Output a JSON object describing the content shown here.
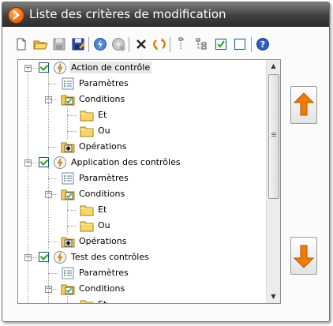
{
  "window": {
    "title": "Liste des critères de modification",
    "title_icon": "chevron-right-icon"
  },
  "toolbar": {
    "buttons": [
      {
        "name": "new-icon"
      },
      {
        "name": "open-folder-icon"
      },
      {
        "name": "save-icon"
      },
      {
        "name": "save-as-icon"
      },
      {
        "name": "validate-icon"
      },
      {
        "name": "validate-all-icon"
      },
      {
        "name": "delete-icon"
      },
      {
        "name": "refresh-icon"
      },
      {
        "name": "insert-icon"
      },
      {
        "name": "tree-view-icon"
      },
      {
        "name": "check-all-icon"
      },
      {
        "name": "uncheck-all-icon"
      },
      {
        "name": "help-icon"
      }
    ]
  },
  "tree": {
    "items": [
      {
        "label": "Action de contrôle",
        "level": 0,
        "icon": "lightning-icon",
        "checked": true,
        "expanded": true,
        "selected": true
      },
      {
        "label": "Paramètres",
        "level": 1,
        "icon": "parameters-icon"
      },
      {
        "label": "Conditions",
        "level": 1,
        "icon": "conditions-folder-icon",
        "expanded": true
      },
      {
        "label": "Et",
        "level": 2,
        "icon": "folder-icon"
      },
      {
        "label": "Ou",
        "level": 2,
        "icon": "folder-icon"
      },
      {
        "label": "Opérations",
        "level": 1,
        "icon": "operations-icon"
      },
      {
        "label": "Application des contrôles",
        "level": 0,
        "icon": "lightning-icon",
        "checked": true,
        "expanded": true
      },
      {
        "label": "Paramètres",
        "level": 1,
        "icon": "parameters-icon"
      },
      {
        "label": "Conditions",
        "level": 1,
        "icon": "conditions-folder-icon",
        "expanded": true
      },
      {
        "label": "Et",
        "level": 2,
        "icon": "folder-icon"
      },
      {
        "label": "Ou",
        "level": 2,
        "icon": "folder-icon"
      },
      {
        "label": "Opérations",
        "level": 1,
        "icon": "operations-icon"
      },
      {
        "label": "Test des contrôles",
        "level": 0,
        "icon": "lightning-icon",
        "checked": true,
        "expanded": true
      },
      {
        "label": "Paramètres",
        "level": 1,
        "icon": "parameters-icon"
      },
      {
        "label": "Conditions",
        "level": 1,
        "icon": "conditions-folder-icon",
        "expanded": true
      },
      {
        "label": "Et",
        "level": 2,
        "icon": "folder-icon"
      }
    ]
  },
  "side_buttons": {
    "up_icon": "arrow-up-icon",
    "down_icon": "arrow-down-icon"
  },
  "annotation": {
    "icon": "red-arrow-icon",
    "color": "#d40000"
  },
  "colors": {
    "titlebar": "#3f3f3f",
    "accent_orange": "#f07c00",
    "check_green": "#21a121"
  }
}
